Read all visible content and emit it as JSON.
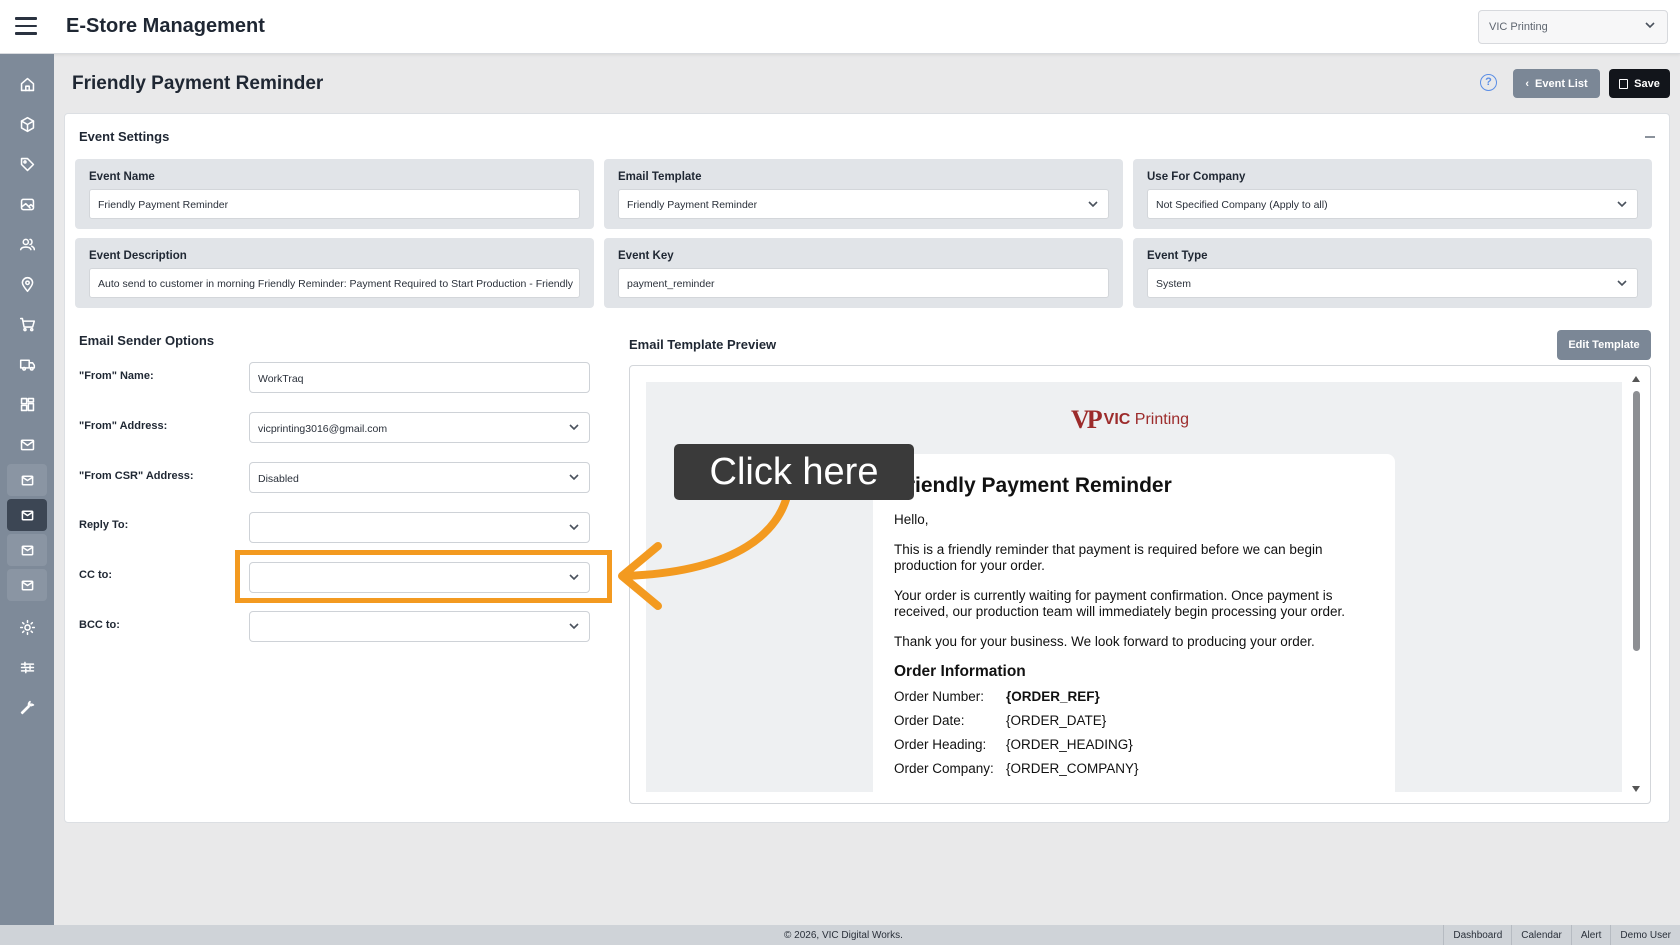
{
  "app": {
    "title": "E-Store Management",
    "company_select": "VIC Printing"
  },
  "page": {
    "title": "Friendly Payment Reminder",
    "help_label": "?"
  },
  "toolbar": {
    "event_list_label": "Event List",
    "save_label": "Save"
  },
  "event_settings": {
    "title": "Event Settings",
    "event_name": {
      "label": "Event Name",
      "value": "Friendly Payment Reminder"
    },
    "email_template": {
      "label": "Email Template",
      "value": "Friendly Payment Reminder"
    },
    "use_for_company": {
      "label": "Use For Company",
      "value": "Not Specified Company (Apply to all)"
    },
    "event_description": {
      "label": "Event Description",
      "value": "Auto send to customer in morning Friendly Reminder: Payment Required to Start Production - Friendly"
    },
    "event_key": {
      "label": "Event Key",
      "value": "payment_reminder"
    },
    "event_type": {
      "label": "Event Type",
      "value": "System"
    }
  },
  "sender_options": {
    "title": "Email Sender Options",
    "from_name": {
      "label": "\"From\" Name:",
      "value": "WorkTraq"
    },
    "from_address": {
      "label": "\"From\" Address:",
      "value": "vicprinting3016@gmail.com"
    },
    "from_csr": {
      "label": "\"From CSR\" Address:",
      "value": "Disabled"
    },
    "reply_to": {
      "label": "Reply To:",
      "value": ""
    },
    "cc_to": {
      "label": "CC to:",
      "value": ""
    },
    "bcc_to": {
      "label": "BCC to:",
      "value": ""
    }
  },
  "preview": {
    "title": "Email Template Preview",
    "edit_label": "Edit Template",
    "logo_mark": "VP",
    "logo_text_bold": "VIC",
    "logo_text": "Printing",
    "heading": "Friendly Payment Reminder",
    "greeting": "Hello,",
    "paragraphs": [
      "This is a friendly reminder that payment is required before we can begin production for your order.",
      "Your order is currently waiting for payment confirmation. Once payment is received, our production team will immediately begin processing your order.",
      "Thank you for your business. We look forward to producing your order."
    ],
    "order_title": "Order Information",
    "order_rows": [
      {
        "k": "Order Number:",
        "v": "{ORDER_REF}"
      },
      {
        "k": "Order Date:",
        "v": "{ORDER_DATE}"
      },
      {
        "k": "Order Heading:",
        "v": "{ORDER_HEADING}"
      },
      {
        "k": "Order Company:",
        "v": "{ORDER_COMPANY}"
      }
    ]
  },
  "callout": {
    "text": "Click here"
  },
  "footer": {
    "copyright": "© 2026, VIC Digital Works.",
    "links": [
      "Dashboard",
      "Calendar",
      "Alert",
      "Demo User"
    ]
  },
  "colors": {
    "highlight": "#f39a20",
    "sidebar": "#7e8a99",
    "primary_dark": "#12151b"
  }
}
